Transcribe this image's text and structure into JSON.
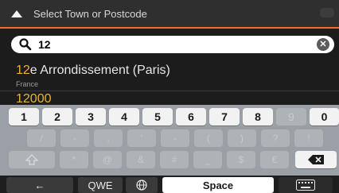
{
  "header": {
    "title": "Select Town or Postcode"
  },
  "search": {
    "value": "12"
  },
  "results": [
    {
      "match": "12",
      "rest": "e Arrondissement (Paris)",
      "subtitle": "France"
    },
    {
      "match": "12",
      "rest": "000",
      "subtitle": ""
    }
  ],
  "keyboard": {
    "row1": [
      "1",
      "2",
      "3",
      "4",
      "5",
      "6",
      "7",
      "8",
      "9",
      "0"
    ],
    "row2": [
      "/",
      "-",
      ",",
      "'",
      "-",
      "(",
      ")",
      "?",
      "!"
    ],
    "row3": [
      "*",
      "@",
      "&",
      "#",
      "_",
      "$",
      "€"
    ],
    "bottom": {
      "left_arrow": "←",
      "layout": "QWE",
      "space": "Space"
    }
  },
  "colors": {
    "accent": "#e8702a",
    "highlight": "#e7b43a"
  }
}
